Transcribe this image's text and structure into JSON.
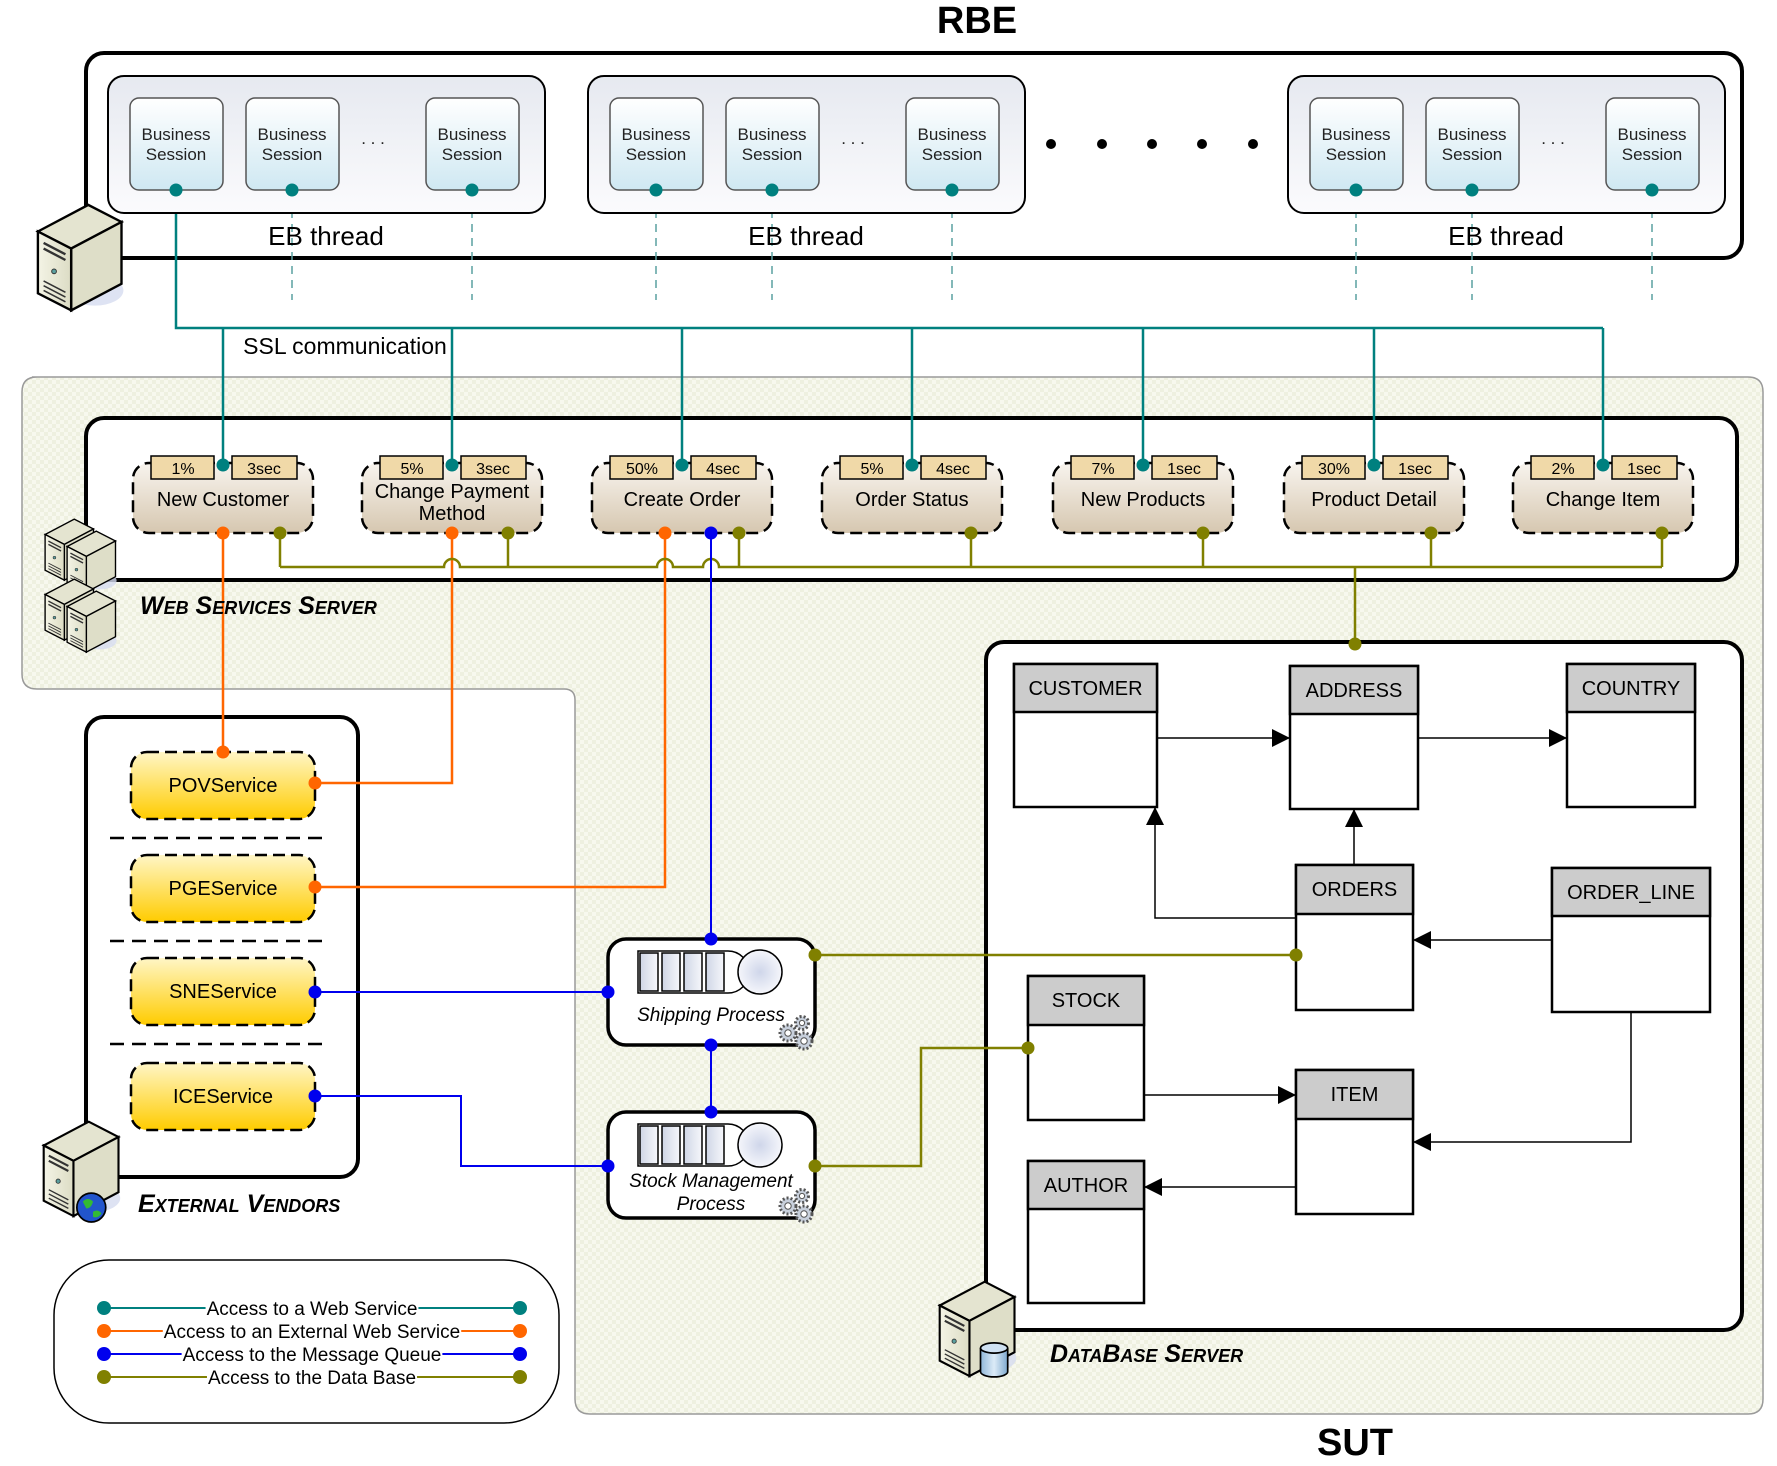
{
  "titles": {
    "rbe": "RBE",
    "sut": "SUT"
  },
  "rbe": {
    "groups": [
      {
        "label": "EB thread",
        "sessions": [
          "Business Session",
          "Business Session",
          "Business Session"
        ],
        "ellipsis": ". . ."
      },
      {
        "label": "EB thread",
        "sessions": [
          "Business Session",
          "Business Session",
          "Business Session"
        ],
        "ellipsis": ". . ."
      },
      {
        "label": "EB thread",
        "sessions": [
          "Business Session",
          "Business Session",
          "Business Session"
        ],
        "ellipsis": ". . ."
      }
    ],
    "group_gap_ellipsis": "• • • • •",
    "ssl_label": "SSL communication"
  },
  "web_services_server": {
    "label": "Web Services Server",
    "transactions": [
      {
        "name": "New Customer",
        "percent": "1%",
        "think_time": "3sec",
        "external": true,
        "queue": false
      },
      {
        "name": "Change Payment Method",
        "name_lines": [
          "Change Payment",
          "Method"
        ],
        "percent": "5%",
        "think_time": "3sec",
        "external": true,
        "queue": false
      },
      {
        "name": "Create Order",
        "percent": "50%",
        "think_time": "4sec",
        "external": true,
        "queue": true
      },
      {
        "name": "Order Status",
        "percent": "5%",
        "think_time": "4sec",
        "external": false,
        "queue": false
      },
      {
        "name": "New Products",
        "percent": "7%",
        "think_time": "1sec",
        "external": false,
        "queue": false
      },
      {
        "name": "Product Detail",
        "percent": "30%",
        "think_time": "1sec",
        "external": false,
        "queue": false
      },
      {
        "name": "Change Item",
        "percent": "2%",
        "think_time": "1sec",
        "external": false,
        "queue": false
      }
    ]
  },
  "external_vendors": {
    "label": "External Vendors",
    "services": [
      "POVService",
      "PGEService",
      "SNEService",
      "ICEService"
    ]
  },
  "processes": [
    {
      "name": "Shipping Process",
      "lines": [
        "Shipping Process"
      ]
    },
    {
      "name": "Stock Management Process",
      "lines": [
        "Stock Management",
        "Process"
      ]
    }
  ],
  "database_server": {
    "label": "DataBase Server",
    "tables": [
      "CUSTOMER",
      "ADDRESS",
      "COUNTRY",
      "ORDERS",
      "ORDER_LINE",
      "STOCK",
      "ITEM",
      "AUTHOR"
    ]
  },
  "legend": {
    "items": [
      {
        "label": "Access to a Web Service",
        "color": "#00807f"
      },
      {
        "label": "Access to an External Web Service",
        "color": "#ff6600"
      },
      {
        "label": "Access to the Message Queue",
        "color": "#0000ee"
      },
      {
        "label": "Access to the Data Base",
        "color": "#808000"
      }
    ]
  },
  "colors": {
    "web_service": "#00807f",
    "external": "#ff6600",
    "queue": "#0000ee",
    "database": "#808000",
    "tag_fill": "#f0d9a8",
    "sut_fill": "#eef0e0",
    "session_fill": "#d9eef6",
    "table_header": "#cccccc",
    "service_fill": "#ffd21a"
  }
}
